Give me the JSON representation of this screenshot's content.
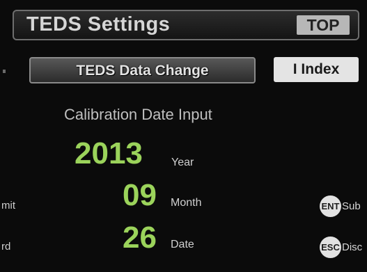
{
  "header": {
    "title": "TEDS Settings",
    "top_label": "TOP"
  },
  "tabs": {
    "active_label": "TEDS Data Change",
    "other_label": "I  Index"
  },
  "main": {
    "heading": "Calibration Date Input",
    "year": {
      "value": "2013",
      "unit": "Year"
    },
    "month": {
      "value": "09",
      "unit": "Month"
    },
    "day": {
      "value": "26",
      "unit": "Date"
    }
  },
  "left_labels": {
    "submit_fragment": "mit",
    "discard_fragment": "rd"
  },
  "actions": {
    "ent": {
      "key": "ENT",
      "label": "Sub"
    },
    "esc": {
      "key": "ESC",
      "label": "Disc"
    }
  },
  "colors": {
    "accent_green": "#9bd35b",
    "background": "#0b0b0b"
  }
}
